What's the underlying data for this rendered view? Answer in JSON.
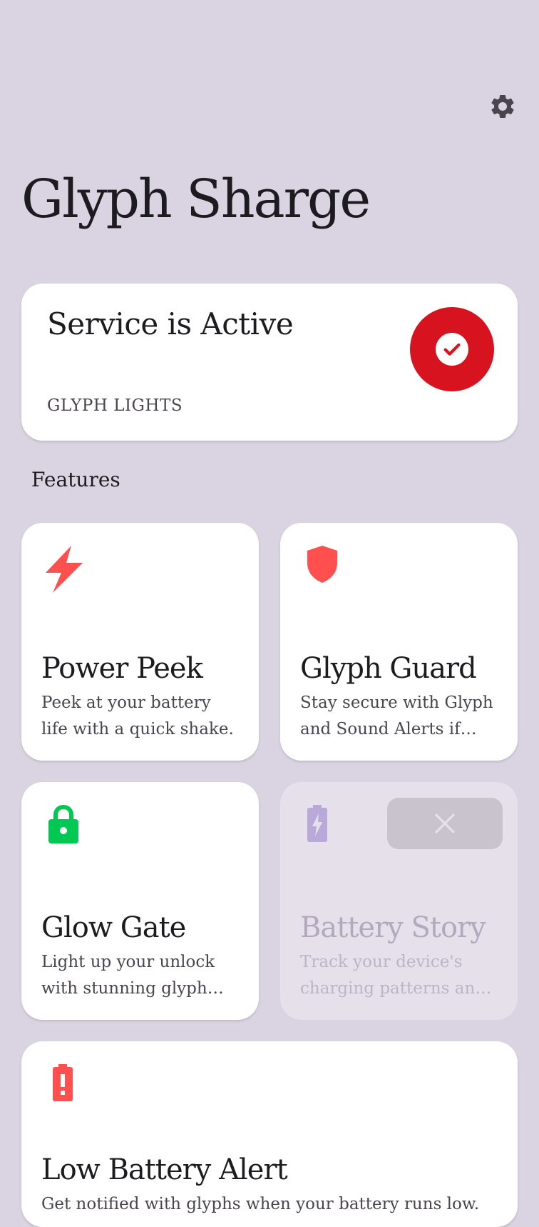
{
  "app": {
    "title": "Glyph Sharge"
  },
  "header": {
    "settings_icon": "gear-icon"
  },
  "service": {
    "title": "Service is Active",
    "subtitle": "GLYPH LIGHTS",
    "status_icon": "check-icon",
    "accent": "#d7131f"
  },
  "features_section": {
    "label": "Features"
  },
  "features": [
    {
      "title": "Power Peek",
      "description": "Peek at your battery life with a quick shake.",
      "icon": "bolt-icon",
      "color": "#ff4f4f",
      "enabled": true
    },
    {
      "title": "Glyph Guard",
      "description": "Stay secure with Glyph and Sound Alerts if Unplugged.",
      "icon": "shield-icon",
      "color": "#ff4f4f",
      "enabled": true
    },
    {
      "title": "Glow Gate",
      "description": "Light up your unlock with stunning glyph animations.",
      "icon": "lock-icon",
      "color": "#00c853",
      "enabled": true
    },
    {
      "title": "Battery Story",
      "description": "Track your device's charging patterns and history.",
      "icon": "battery-charging-icon",
      "color": "#b8a9d9",
      "enabled": false,
      "close_icon": "close-icon"
    },
    {
      "title": "Low Battery Alert",
      "description": "Get notified with glyphs when your battery runs low.",
      "icon": "battery-alert-icon",
      "color": "#ff4f4f",
      "enabled": true
    }
  ]
}
